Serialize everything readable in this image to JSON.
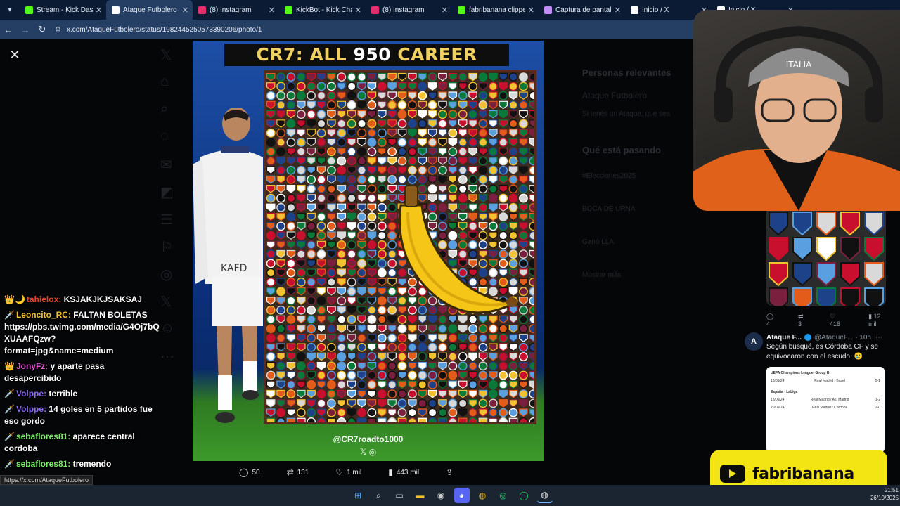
{
  "browser": {
    "tabs": [
      {
        "label": "Stream - Kick Dashbo",
        "icon": "kick-icon",
        "color": "#53fc18"
      },
      {
        "label": "Ataque Futbolero en",
        "icon": "x-icon",
        "color": "#ffffff",
        "active": true
      },
      {
        "label": "(8) Instagram",
        "icon": "instagram-icon",
        "color": "#e1306c"
      },
      {
        "label": "KickBot - Kick Chatbo",
        "icon": "kickbot-icon",
        "color": "#53fc18"
      },
      {
        "label": "(8) Instagram",
        "icon": "instagram-icon",
        "color": "#e1306c"
      },
      {
        "label": "fabribanana clipped",
        "icon": "clip-icon",
        "color": "#53fc18"
      },
      {
        "label": "Captura de pantalla p",
        "icon": "capture-icon",
        "color": "#c58af9"
      },
      {
        "label": "Inicio / X",
        "icon": "x-icon",
        "color": "#ffffff"
      },
      {
        "label": "Inicio / X",
        "icon": "x-icon",
        "color": "#ffffff"
      }
    ],
    "url": "x.com/AtaqueFutbolero/status/1982445250573390206/photo/1"
  },
  "photo": {
    "title_prefix": "CR7: ALL ",
    "title_number": "950",
    "title_suffix": " CAREER GOALS",
    "player_name": "KAFD",
    "handle": "@CR7roadto1000",
    "social_icons": "𝕏 ◎"
  },
  "post_actions": {
    "replies": "50",
    "reposts": "131",
    "likes": "1 mil",
    "views": "443 mil"
  },
  "twitter_ghost": {
    "relevant_people": "Personas relevantes",
    "account": "Ataque Futbolero",
    "account_bio": "Si tenés un Ataque, que sea",
    "trending_title": "Qué está pasando",
    "trend_1": "#Elecciones2025",
    "trend_2": "BOCA DE URNA",
    "trend_3": "Ganó LLA",
    "show_more": "Mostrar más"
  },
  "reply": {
    "stats": {
      "replies": "4",
      "reposts": "3",
      "likes": "418",
      "views": "12 mil"
    },
    "name": "Ataque F...",
    "handle": "@AtaqueF...",
    "time": "· 10h",
    "text": "Según busqué, es Córdoba CF y se equivocaron con el escudo. 🥲",
    "card": {
      "competition": "UEFA Champions League, Group B",
      "match1_date": "18/09/24",
      "match1_home": "Real Madrid",
      "match1_away": "Basel",
      "match1_score_home": "5",
      "match1_score_away": "1",
      "league": "España · LaLiga",
      "match2_date": "13/09/24",
      "match2_home": "Real Madrid",
      "match2_away": "Atl. Madrid",
      "match2_score_home": "1",
      "match2_score_away": "2",
      "match3_date": "20/09/24",
      "match3_home": "Real Madrid",
      "match3_away": "Córdoba",
      "match3_score_home": "2",
      "match3_score_away": "0"
    }
  },
  "brand": {
    "name": "fabribanana",
    "color": "#f3e514"
  },
  "chat": [
    {
      "badge": "👑🌙",
      "user": "tahielox:",
      "user_color": "#e8452c",
      "text": " KSJAKJKJSAKSAJ"
    },
    {
      "badge": "🗡️",
      "user": "Leoncito_RC:",
      "user_color": "#f2c230",
      "text": " FALTAN BOLETAS https://pbs.twimg.com/media/G4Oj7bQXUAAFQzw?format=jpg&name=medium"
    },
    {
      "badge": "👑",
      "user": "JonyFz:",
      "user_color": "#e05bd6",
      "text": " y aparte pasa desapercibido"
    },
    {
      "badge": "🗡️",
      "user": "Volppe:",
      "user_color": "#8c6cf5",
      "text": " terrible"
    },
    {
      "badge": "🗡️",
      "user": "Volppe:",
      "user_color": "#8c6cf5",
      "text": " 14 goles en 5 partidos fue eso gordo"
    },
    {
      "badge": "🗡️",
      "user": "sebaflores81:",
      "user_color": "#7cf06b",
      "text": " aparece central cordoba"
    },
    {
      "badge": "🗡️",
      "user": "sebaflores81:",
      "user_color": "#7cf06b",
      "text": " tremendo"
    }
  ],
  "status_url": "https://x.com/AtaqueFutbolero",
  "clock": {
    "time": "21:51",
    "date": "26/10/2025"
  },
  "taskbar_icons": [
    "windows-icon",
    "search-icon",
    "task-view-icon",
    "file-explorer-icon",
    "obs-icon",
    "discord-icon",
    "chrome-icon",
    "spotify-icon",
    "whatsapp-icon",
    "chrome-alt-icon"
  ]
}
